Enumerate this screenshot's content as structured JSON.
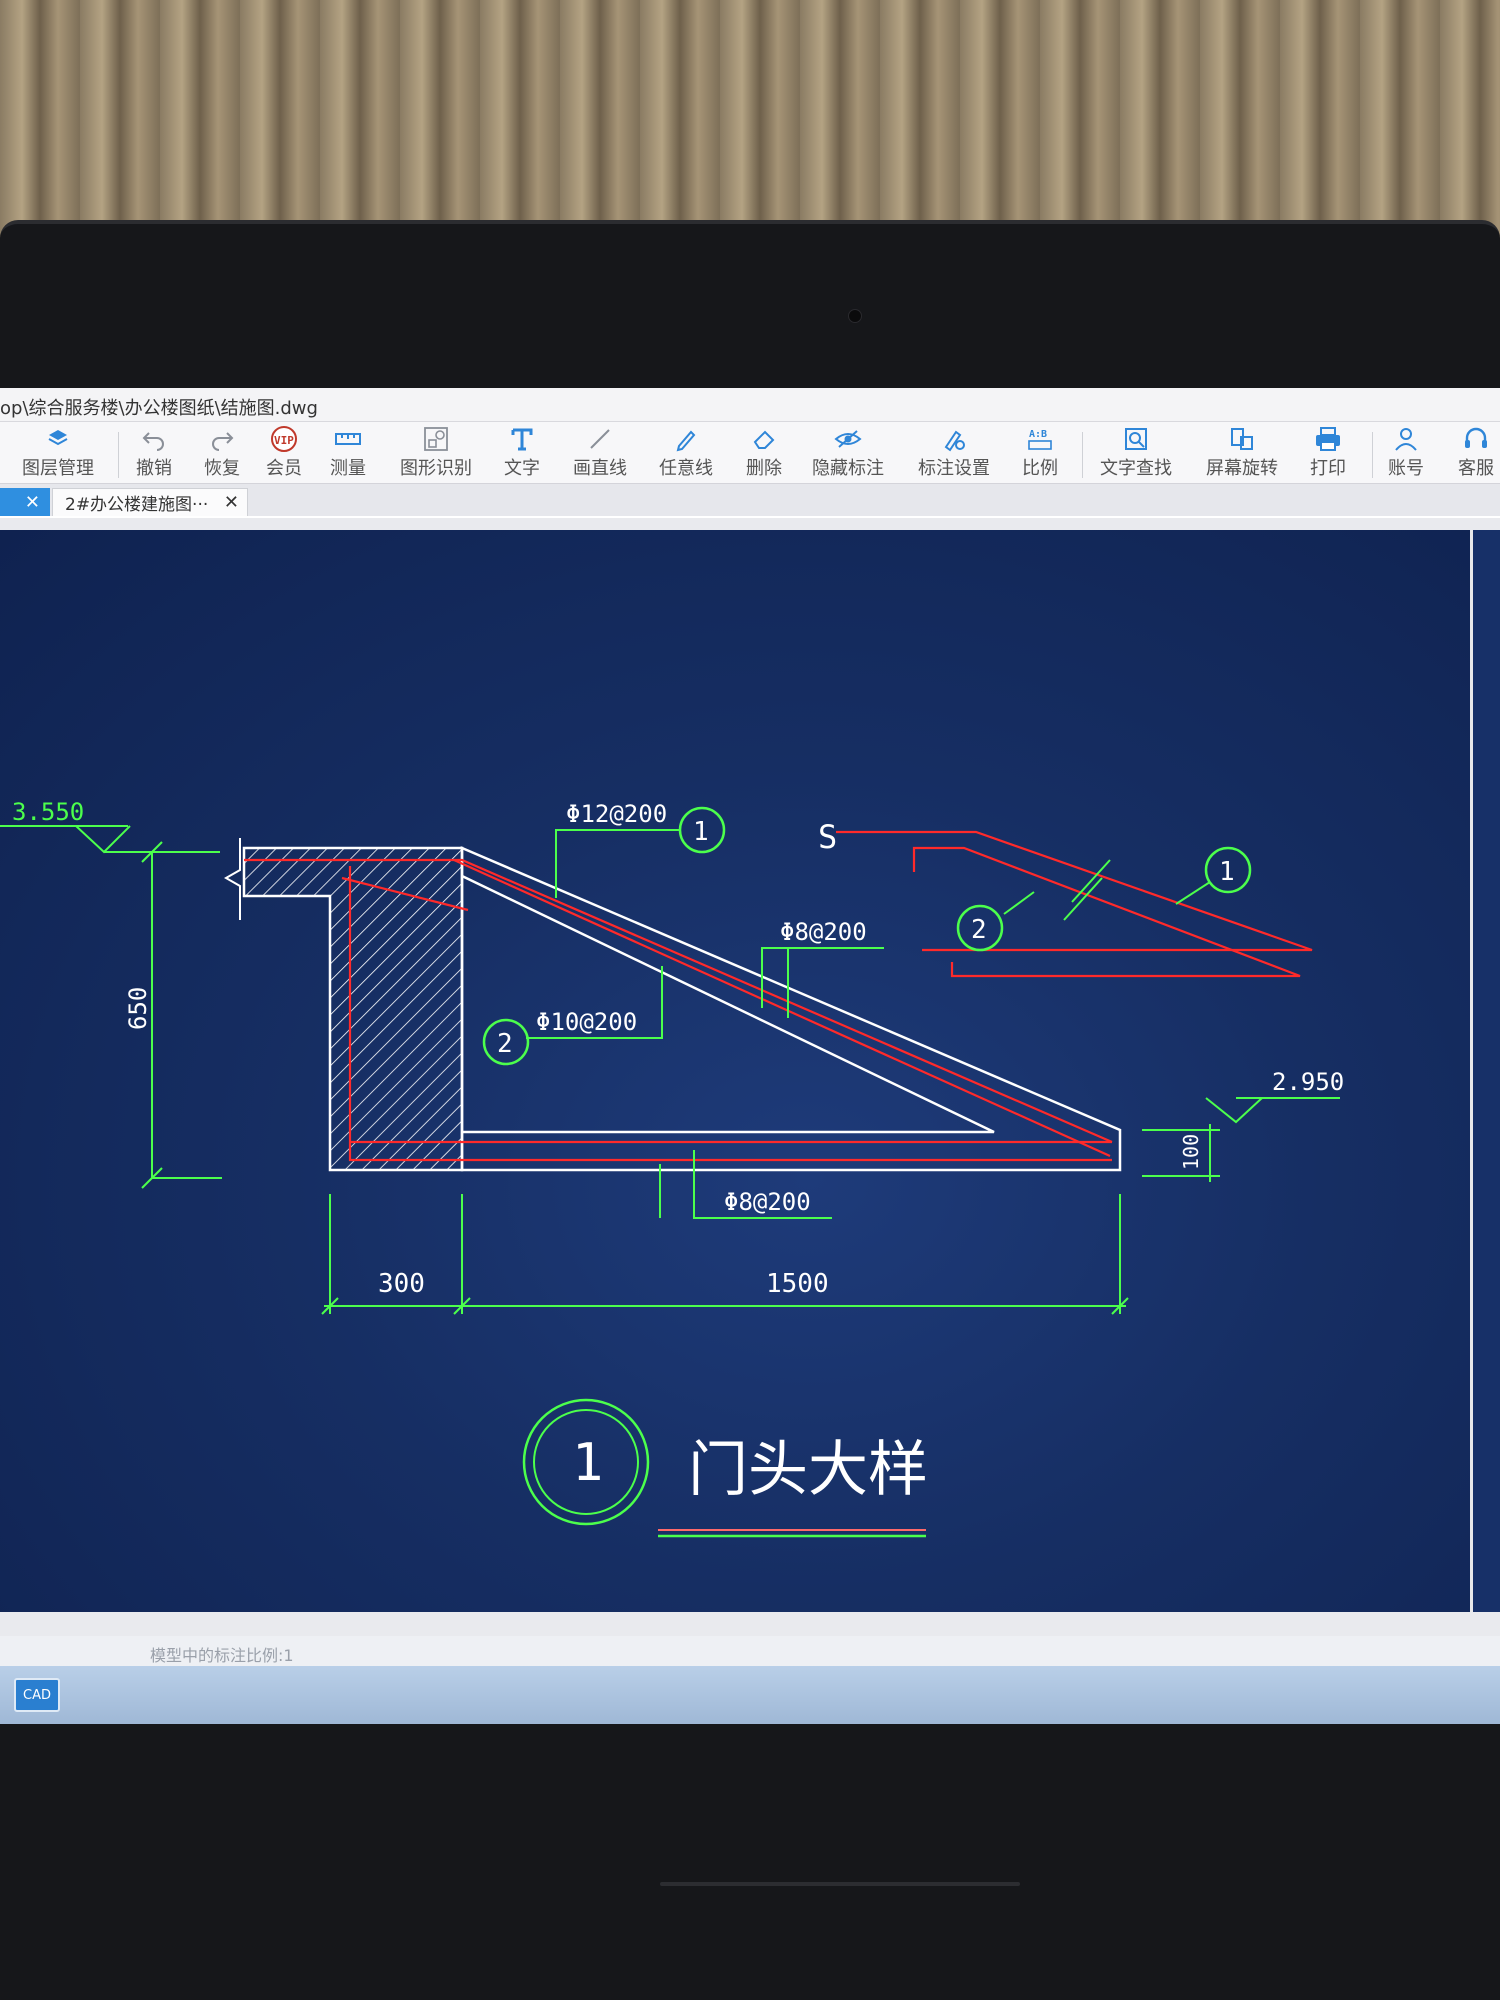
{
  "window": {
    "title_path": "op\\综合服务楼\\办公楼图纸\\结施图.dwg"
  },
  "toolbar": {
    "items": [
      {
        "label": "图层管理",
        "icon": "layers-icon"
      },
      {
        "label": "撤销",
        "icon": "undo-icon"
      },
      {
        "label": "恢复",
        "icon": "redo-icon"
      },
      {
        "label": "会员",
        "icon": "vip-icon"
      },
      {
        "label": "测量",
        "icon": "ruler-icon"
      },
      {
        "label": "图形识别",
        "icon": "shape-recognition-icon"
      },
      {
        "label": "文字",
        "icon": "text-icon"
      },
      {
        "label": "画直线",
        "icon": "line-icon"
      },
      {
        "label": "任意线",
        "icon": "pen-icon"
      },
      {
        "label": "删除",
        "icon": "eraser-icon"
      },
      {
        "label": "隐藏标注",
        "icon": "eye-hide-icon"
      },
      {
        "label": "标注设置",
        "icon": "annotation-settings-icon"
      },
      {
        "label": "比例",
        "icon": "scale-icon"
      },
      {
        "label": "文字查找",
        "icon": "text-search-icon"
      },
      {
        "label": "屏幕旋转",
        "icon": "rotate-screen-icon"
      },
      {
        "label": "打印",
        "icon": "printer-icon"
      },
      {
        "label": "账号",
        "icon": "account-icon"
      },
      {
        "label": "客服",
        "icon": "headset-icon"
      }
    ],
    "vip_badge": "VIP",
    "scale_badge": "A:B"
  },
  "tabs": {
    "active_close": "✕",
    "doc_tab_label": "2#办公楼建施图···",
    "doc_tab_close": "✕"
  },
  "drawing": {
    "elev_top": "3.550",
    "elev_bottom": "2.950",
    "rebar_1": "Φ12@200",
    "rebar_2": "Φ10@200",
    "rebar_top_dist": "Φ8@200",
    "rebar_bottom_dist": "Φ8@200",
    "callout_1": "1",
    "callout_2": "2",
    "dim_height": "650",
    "dim_wall": "300",
    "dim_span": "1500",
    "dim_tip": "100",
    "detail_number": "1",
    "detail_title": "门头大样",
    "s_mark": "S"
  },
  "status": {
    "scale_text": "模型中的标注比例:1"
  },
  "taskbar": {
    "app_label": "CAD"
  },
  "colors": {
    "canvas": "#162e63",
    "line_green": "#4cff4c",
    "line_red": "#ff2a2a",
    "line_white": "#ffffff",
    "toolbar_icon": "#2f86d8",
    "active_tab": "#2f8fe0"
  }
}
